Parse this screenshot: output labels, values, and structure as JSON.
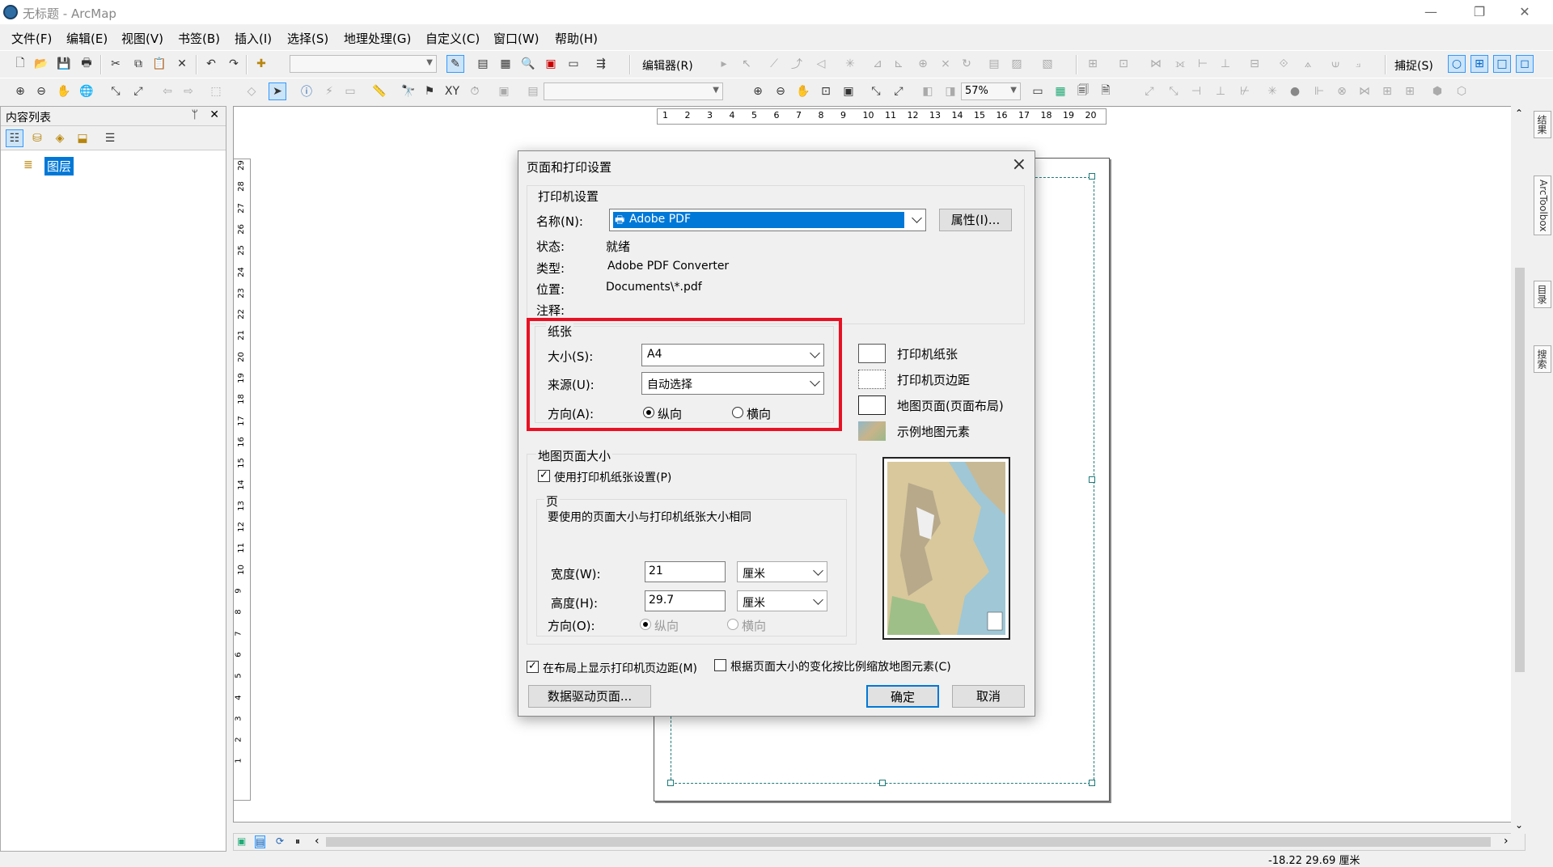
{
  "window": {
    "title": "无标题 - ArcMap",
    "minimize": "—",
    "restore": "❐",
    "close": "✕"
  },
  "menu": [
    "文件(F)",
    "编辑(E)",
    "视图(V)",
    "书签(B)",
    "插入(I)",
    "选择(S)",
    "地理处理(G)",
    "自定义(C)",
    "窗口(W)",
    "帮助(H)"
  ],
  "toolbar": {
    "editor_label": "编辑器(R)",
    "snap_label": "捕捉(S)",
    "zoom_value": "57%"
  },
  "toc": {
    "title": "内容列表",
    "pin": "ᛘ",
    "close": "✕",
    "layer_label": "图层"
  },
  "ruler": {
    "h_ticks": [
      "1",
      "2",
      "3",
      "4",
      "5",
      "6",
      "7",
      "8",
      "9",
      "10",
      "11",
      "12",
      "13",
      "14",
      "15",
      "16",
      "17",
      "18",
      "19",
      "20"
    ],
    "v_ticks": [
      "29",
      "28",
      "27",
      "26",
      "25",
      "24",
      "23",
      "22",
      "21",
      "20",
      "19",
      "18",
      "17",
      "16",
      "15",
      "14",
      "13",
      "12",
      "11",
      "10",
      "9",
      "8",
      "7",
      "6",
      "5",
      "4",
      "3",
      "2",
      "1"
    ]
  },
  "dock_tabs": [
    "结果",
    "ArcToolbox",
    "目录",
    "搜索"
  ],
  "status": {
    "coords": "-18.22  29.69 厘米"
  },
  "dialog": {
    "title": "页面和打印设置",
    "printer_group": "打印机设置",
    "name_label": "名称(N):",
    "name_value": "Adobe PDF",
    "properties_button": "属性(I)...",
    "status_label": "状态:",
    "status_value": "就绪",
    "type_label": "类型:",
    "type_value": "Adobe PDF Converter",
    "location_label": "位置:",
    "location_value": "Documents\\*.pdf",
    "comment_label": "注释:",
    "paper_group": "纸张",
    "size_label": "大小(S):",
    "size_value": "A4",
    "source_label": "来源(U):",
    "source_value": "自动选择",
    "orientation_label": "方向(A):",
    "portrait": "纵向",
    "landscape": "横向",
    "legend": [
      "打印机纸张",
      "打印机页边距",
      "地图页面(页面布局)",
      "示例地图元素"
    ],
    "map_page_group": "地图页面大小",
    "use_printer_paper": "使用打印机纸张设置(P)",
    "page_group": "页",
    "page_note": "要使用的页面大小与打印机纸张大小相同",
    "width_label": "宽度(W):",
    "width_value": "21",
    "width_unit": "厘米",
    "height_label": "高度(H):",
    "height_value": "29.7",
    "height_unit": "厘米",
    "page_orientation_label": "方向(O):",
    "show_margins": "在布局上显示打印机页边距(M)",
    "scale_elements": "根据页面大小的变化按比例缩放地图元素(C)",
    "data_driven_button": "数据驱动页面...",
    "ok_button": "确定",
    "cancel_button": "取消"
  },
  "colors": {
    "highlight": "#e81123",
    "selection": "#0078d7",
    "dash": "#1f7a7a"
  }
}
